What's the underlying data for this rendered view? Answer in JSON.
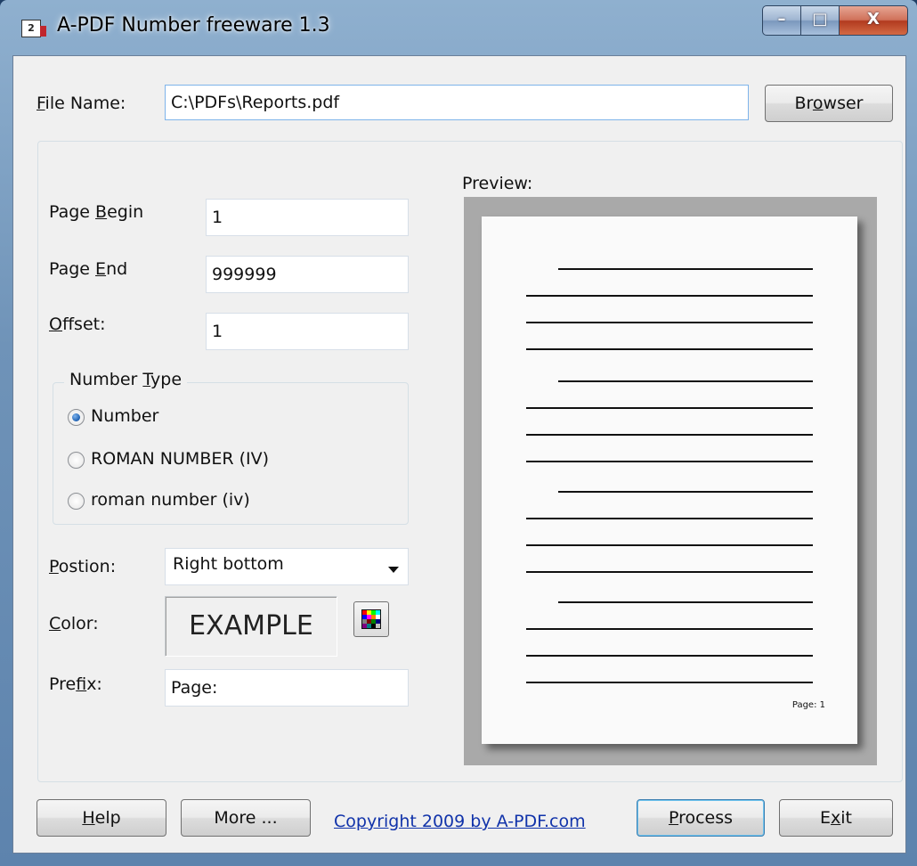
{
  "window": {
    "title": "A-PDF Number freeware 1.3",
    "app_icon_text": "2",
    "controls": {
      "minimize": "–",
      "maximize": "□",
      "close": "X"
    }
  },
  "file": {
    "label_prefix": "",
    "label_underlined": "F",
    "label_rest": "ile Name:",
    "value": "C:\\PDFs\\Reports.pdf",
    "browse_underlined": "o",
    "browse_before": "Br",
    "browse_after": "wser"
  },
  "pages": {
    "begin_before": "Page ",
    "begin_underlined": "B",
    "begin_after": "egin",
    "begin_value": "1",
    "end_before": "Page ",
    "end_underlined": "E",
    "end_after": "nd",
    "end_value": "999999",
    "offset_underlined": "O",
    "offset_after": "ffset:",
    "offset_value": "1"
  },
  "number_type": {
    "legend_before": "Number ",
    "legend_underlined": "T",
    "legend_after": "ype",
    "options": [
      "Number",
      "ROMAN NUMBER (IV)",
      "roman number (iv)"
    ],
    "selected_index": 0
  },
  "position": {
    "label_underlined": "P",
    "label_after": "ostion:",
    "value": "Right bottom"
  },
  "color": {
    "label_underlined": "C",
    "label_after": "olor:",
    "example_text": "EXAMPLE",
    "palette": [
      "#ff0000",
      "#ffff00",
      "#00ff00",
      "#00ffff",
      "#0000ff",
      "#ff00ff",
      "#ff8000",
      "#ffffff",
      "#808080",
      "#800000",
      "#008000",
      "#000080",
      "#800080",
      "#008080",
      "#000000",
      "#c0c0c0"
    ]
  },
  "prefix": {
    "label_before": "Pre",
    "label_underlined": "f",
    "label_after": "ix:",
    "value": "Page:"
  },
  "preview": {
    "label": "Preview:",
    "page_number_text": "Page: 1"
  },
  "footer": {
    "help_underlined": "H",
    "help_after": "elp",
    "more_label": "More ...",
    "copyright": "Copyright 2009 by A-PDF.com",
    "process_underlined": "P",
    "process_after": "rocess",
    "exit_before": "E",
    "exit_underlined": "x",
    "exit_after": "it"
  }
}
